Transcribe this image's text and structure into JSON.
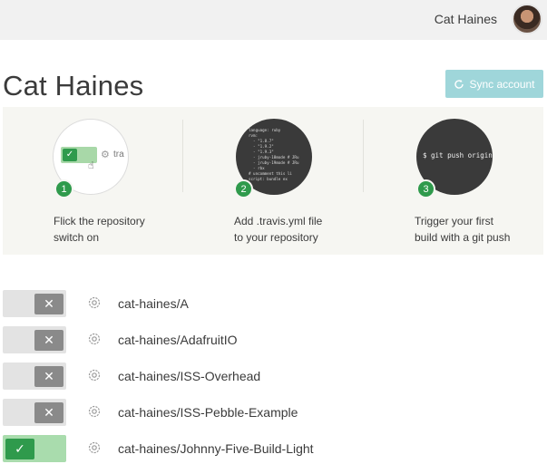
{
  "topbar": {
    "user_name": "Cat Haines"
  },
  "page": {
    "title": "Cat Haines",
    "sync_label": "Sync account"
  },
  "steps": [
    {
      "number": "1",
      "line1": "Flick the repository",
      "line2": "switch on",
      "illustration_text": "tra"
    },
    {
      "number": "2",
      "line1": "Add .travis.yml file",
      "line2": "to your repository",
      "code": "language: ruby\nrvm:\n  - \"1.8.7\"\n  - \"1.9.2\"\n  - \"1.9.3\"\n  - jruby-18mode # JRu\n  - jruby-19mode # JRu\n  - rbx\n# uncomment this li\nscript: bundle ex"
    },
    {
      "number": "3",
      "line1": "Trigger your first",
      "line2": "build with a git push",
      "command": "$ git push origin"
    }
  ],
  "repos": [
    {
      "name": "cat-haines/A",
      "enabled": false,
      "toggle_icon": "x-icon"
    },
    {
      "name": "cat-haines/AdafruitIO",
      "enabled": false,
      "toggle_icon": "x-icon"
    },
    {
      "name": "cat-haines/ISS-Overhead",
      "enabled": false,
      "toggle_icon": "x-icon"
    },
    {
      "name": "cat-haines/ISS-Pebble-Example",
      "enabled": false,
      "toggle_icon": "x-icon"
    },
    {
      "name": "cat-haines/Johnny-Five-Build-Light",
      "enabled": true,
      "toggle_icon": "check-icon"
    }
  ],
  "colors": {
    "accent_green": "#2f9a4c",
    "sync_button": "#9fd6da",
    "toggle_off_knob": "#8a8a8a"
  }
}
